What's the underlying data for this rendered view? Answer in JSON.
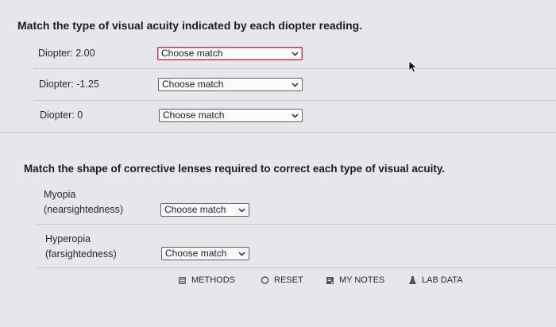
{
  "section1": {
    "heading": "Match the type of visual acuity indicated by each diopter reading.",
    "rows": [
      {
        "label": "Diopter: 2.00",
        "select_value": "Choose match"
      },
      {
        "label": "Diopter: -1.25",
        "select_value": "Choose match"
      },
      {
        "label": "Diopter: 0",
        "select_value": "Choose match"
      }
    ]
  },
  "section2": {
    "heading": "Match the shape of corrective lenses required to correct each type of visual acuity.",
    "rows": [
      {
        "label_line1": "Myopia",
        "label_line2": "(nearsightedness)",
        "select_value": "Choose match"
      },
      {
        "label_line1": "Hyperopia",
        "label_line2": "(farsightedness)",
        "select_value": "Choose match"
      }
    ]
  },
  "footer": {
    "items": [
      {
        "label": "METHODS",
        "icon": "methods-icon"
      },
      {
        "label": "RESET",
        "icon": "reset-icon"
      },
      {
        "label": "MY NOTES",
        "icon": "notes-icon"
      },
      {
        "label": "LAB DATA",
        "icon": "lab-data-icon"
      }
    ]
  },
  "colors": {
    "background": "#e6e7ea",
    "active_select_border": "#c62b35",
    "divider": "#c7c9cd"
  }
}
